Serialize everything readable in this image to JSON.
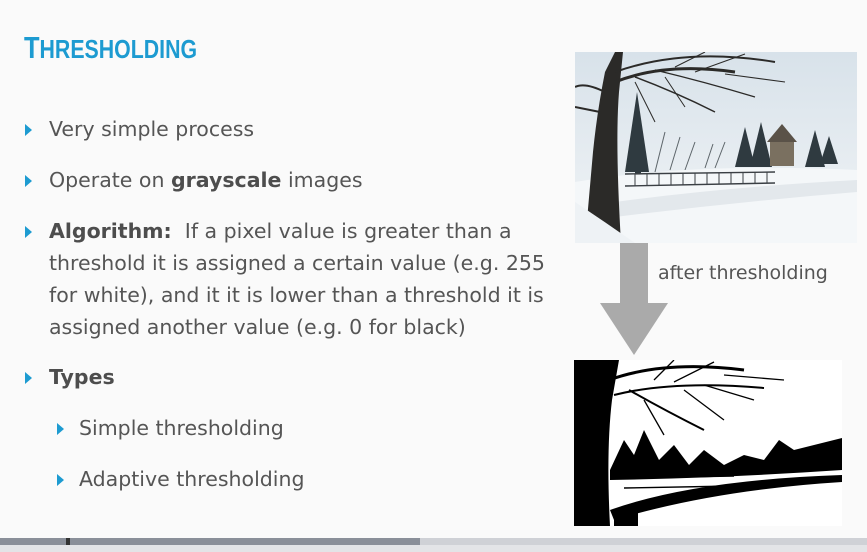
{
  "slide": {
    "title_first": "T",
    "title_rest": "HRESHOLDING",
    "bullets": {
      "b1": "Very simple process",
      "b2_pre": "Operate on ",
      "b2_bold": "grayscale",
      "b2_post": " images",
      "b3_bold": "Algorithm:",
      "b3_line1": "  If a pixel value is greater than a",
      "b3_line2": "threshold it is assigned a certain value (e.g. 255",
      "b3_line3": "for white), and it it is lower than a threshold it is",
      "b3_line4": "assigned another value (e.g. 0 for black)",
      "b4_bold": "Types",
      "sub1": "Simple thresholding",
      "sub2": "Adaptive thresholding"
    },
    "arrow_caption": "after thresholding",
    "images": {
      "top": "winter-park-photo",
      "bottom": "thresholded-photo"
    }
  },
  "colors": {
    "accent": "#1d9bd1",
    "text": "#555555",
    "arrow": "#aaaaaa"
  },
  "player": {
    "progress": 0.48
  }
}
